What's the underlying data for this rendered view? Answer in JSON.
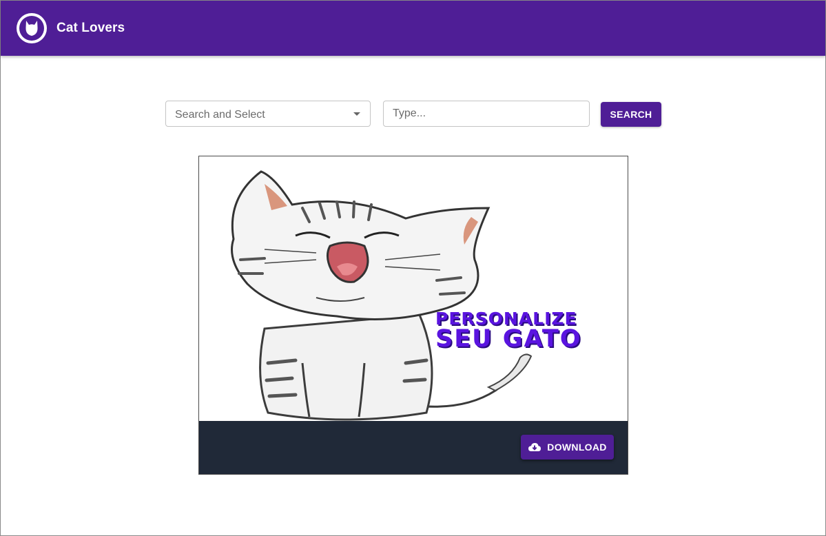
{
  "app": {
    "title": "Cat Lovers",
    "brand_color": "#4f1e96"
  },
  "search": {
    "select_placeholder": "Search and Select",
    "input_placeholder": "Type...",
    "button_label": "SEARCH"
  },
  "card": {
    "image": {
      "description_icon": "cat-illustration",
      "overlay_line1": "PERSONALIZE",
      "overlay_line2": "SEU GATO"
    },
    "download_label": "DOWNLOAD",
    "footer_color": "#202938"
  }
}
